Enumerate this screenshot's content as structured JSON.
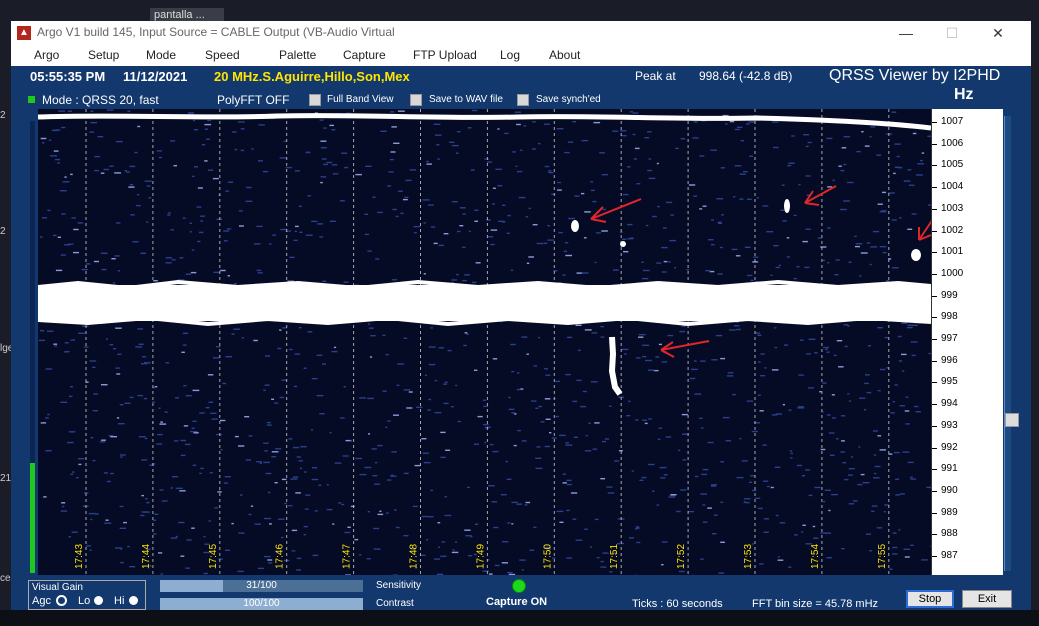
{
  "desktop": {
    "taskbar_tab": "pantalla ...",
    "left_fragments": [
      "2",
      "2",
      "lge",
      "21",
      "ces"
    ]
  },
  "window": {
    "title": "Argo V1 build 145, Input Source = CABLE Output (VB-Audio Virtual",
    "controls": {
      "minimize": "—",
      "maximize": "☐",
      "close": "✕"
    }
  },
  "menu": [
    "Argo",
    "Setup",
    "Mode",
    "Speed",
    "Palette",
    "Capture",
    "FTP Upload",
    "Log",
    "About"
  ],
  "status": {
    "time": "05:55:35 PM",
    "date": "11/12/2021",
    "station": "20 MHz.S.Aguirre,Hillo,Son,Mex",
    "peak_label": "Peak at",
    "peak_value": "998.64 (-42.8 dB)",
    "brand": "QRSS Viewer by I2PHD",
    "unit": "Hz"
  },
  "options": {
    "mode": "Mode : QRSS 20, fast",
    "polyfft": "PolyFFT OFF",
    "full_band": "Full Band View",
    "save_wav": "Save to WAV file",
    "save_synched": "Save synch'ed"
  },
  "time_labels": [
    "17:43",
    "17:44",
    "17:45",
    "17:46",
    "17:47",
    "17:48",
    "17:49",
    "17:50",
    "17:51",
    "17:52",
    "17:53",
    "17:54",
    "17:55"
  ],
  "freq_labels": [
    "1007",
    "1006",
    "1005",
    "1004",
    "1003",
    "1002",
    "1001",
    "1000",
    "999",
    "998",
    "997",
    "996",
    "995",
    "994",
    "993",
    "992",
    "991",
    "990",
    "989",
    "988",
    "987"
  ],
  "bottom": {
    "visual_gain": "Visual Gain",
    "agc": "Agc",
    "lo": "Lo",
    "hi": "Hi",
    "sensitivity_value": "31/100",
    "sensitivity_level": 0.31,
    "sensitivity_label": "Sensitivity",
    "contrast_value": "100/100",
    "contrast_level": 1.0,
    "contrast_label": "Contrast",
    "capture": "Capture ON",
    "ticks": "Ticks  : 60 seconds",
    "fft_bin": "FFT bin size = 45.78 mHz",
    "stop": "Stop",
    "exit": "Exit"
  },
  "colors": {
    "window_bg": "#13386d",
    "station_text": "#ffe600",
    "time_label": "#ffe600",
    "led_green": "#1ec81e"
  }
}
